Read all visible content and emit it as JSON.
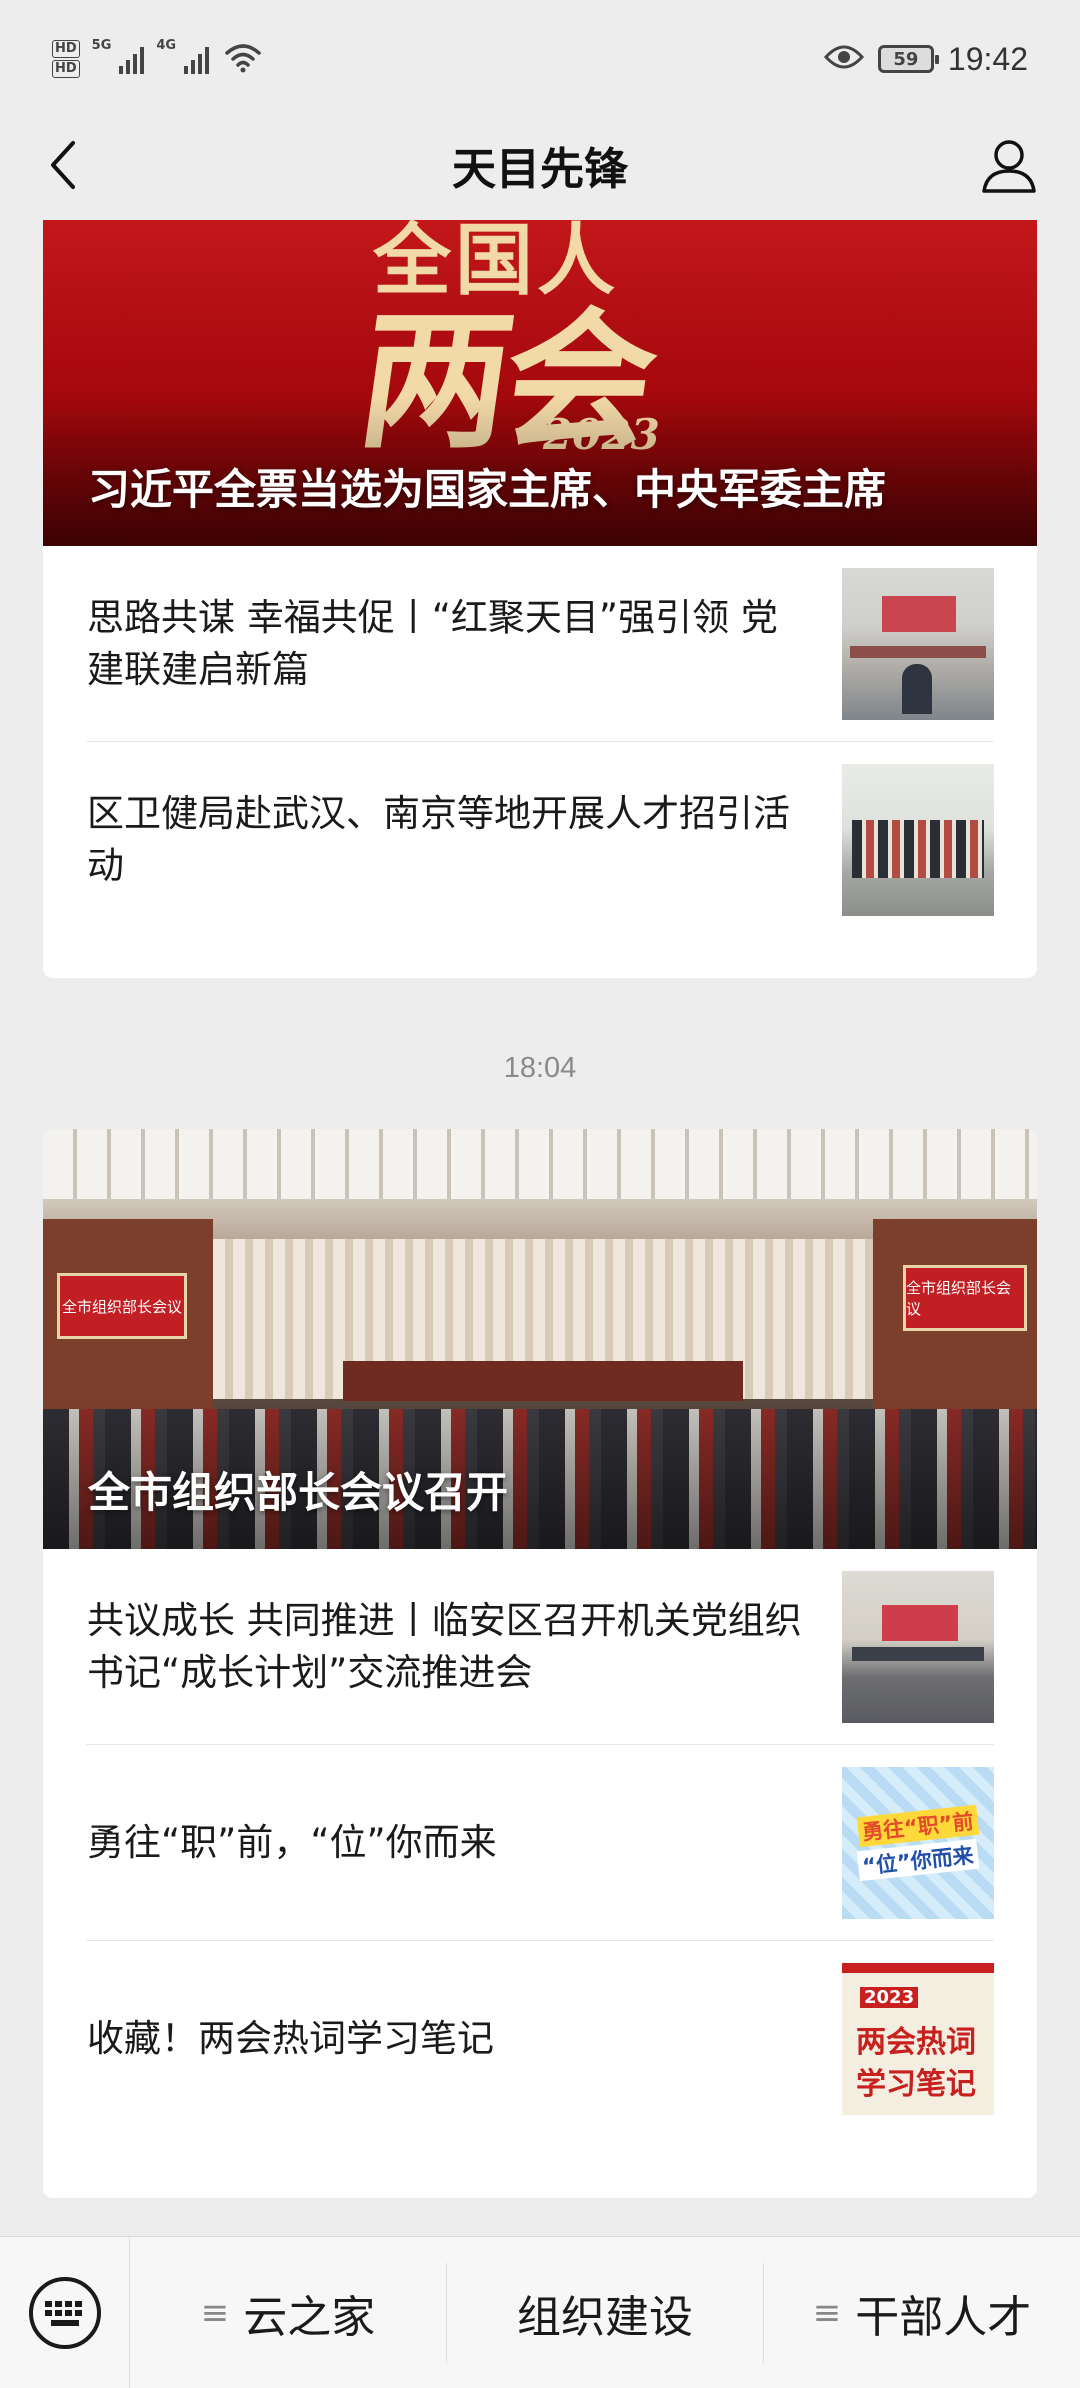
{
  "status_bar": {
    "hd1": "HD",
    "hd2": "HD",
    "net1": "5G",
    "net2": "4G",
    "battery": "59",
    "time": "19:42"
  },
  "nav": {
    "title": "天目先锋"
  },
  "card1": {
    "hero_art_line1": "全国人",
    "hero_art_line2": "两会",
    "hero_art_year": "2023",
    "hero_caption": "习近平全票当选为国家主席、中央军委主席",
    "items": [
      {
        "title": "思路共谋  幸福共促丨“红聚天目”强引领  党建联建启新篇"
      },
      {
        "title": "区卫健局赴武汉、南京等地开展人才招引活动"
      }
    ]
  },
  "timestamp": "18:04",
  "card2": {
    "hero_banner_left": "全市组织部长会议",
    "hero_banner_right": "全市组织部长会议",
    "hero_caption": "全市组织部长会议召开",
    "items": [
      {
        "title": "共议成长 共同推进丨临安区召开机关党组织书记“成长计划”交流推进会"
      },
      {
        "title": "勇往“职”前，“位”你而来",
        "thumb_text1": "勇往“职”前",
        "thumb_text2": "“位”你而来"
      },
      {
        "title": "收藏！两会热词学习笔记",
        "thumb_year": "2023",
        "thumb_text1": "两会热词",
        "thumb_text2": "学习笔记"
      }
    ]
  },
  "bottom_menu": {
    "items": [
      {
        "label": "云之家",
        "icon": "menu-lines-icon"
      },
      {
        "label": "组织建设"
      },
      {
        "label": "干部人才",
        "icon": "menu-lines-icon"
      }
    ]
  },
  "colors": {
    "accent_red": "#b30f12",
    "background": "#ededed"
  }
}
